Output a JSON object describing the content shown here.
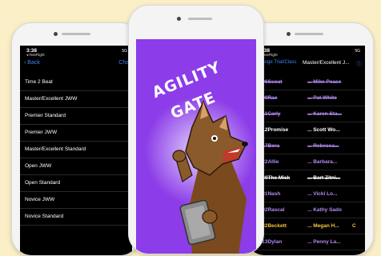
{
  "colors": {
    "background": "#fbefc7",
    "screen_purple": "#8c3ce8",
    "link_blue": "#3b82f6",
    "row_purple": "#b48cf2",
    "row_white": "#ffffff",
    "row_gold": "#f5c542"
  },
  "left_phone": {
    "time": "3:38",
    "carrier": "◂ TestFlight",
    "signal": "5G",
    "back_label": "Back",
    "partial_link": "Chan",
    "classes": [
      "Time 2 Beat",
      "Master/Excellent JWW",
      "Premier Standard",
      "Premier JWW",
      "Master/Excellent Standard",
      "Open JWW",
      "Open Standard",
      "Novice JWW",
      "Novice Standard"
    ]
  },
  "center_phone": {
    "app_title_line1": "AGILITY",
    "app_title_line2": "GATE",
    "mascot_icon": "dog-mascot-icon"
  },
  "right_phone": {
    "time": "3:38",
    "carrier": "◂ TestFlight",
    "signal": "5G",
    "back_label": "‹ Change Trial/Class",
    "header_title": "Master/Excellent J...",
    "runs": [
      {
        "dog": "1606Scout",
        "handler": "... Mike Pease",
        "extra": "",
        "color": "#b48cf2",
        "struck": true
      },
      {
        "dog": "1609Rae",
        "handler": "... Pat White",
        "extra": "",
        "color": "#b48cf2",
        "struck": true
      },
      {
        "dog": "1611Carly",
        "handler": "... Karen Sta...",
        "extra": "",
        "color": "#b48cf2",
        "struck": true
      },
      {
        "dog": "1612Promise",
        "handler": "... Scott Wo...",
        "extra": "",
        "color": "#ffffff",
        "struck": false
      },
      {
        "dog": "1617Bora",
        "handler": "... Rebecca...",
        "extra": "",
        "color": "#b48cf2",
        "struck": true
      },
      {
        "dog": "1622Allie",
        "handler": "... Barbara...",
        "extra": "",
        "color": "#b48cf2",
        "struck": false
      },
      {
        "dog": "1630The Mick",
        "handler": "... Bart Zitni...",
        "extra": "",
        "color": "#ffffff",
        "struck": true
      },
      {
        "dog": "2031Nash",
        "handler": "... Vicki Lo...",
        "extra": "",
        "color": "#b48cf2",
        "struck": false
      },
      {
        "dog": "1602Rascal",
        "handler": "... Kathy Sado",
        "extra": "",
        "color": "#b48cf2",
        "struck": false
      },
      {
        "dog": "1632Beckett",
        "handler": "... Megan H...",
        "extra": "C",
        "color": "#f5c542",
        "struck": false
      },
      {
        "dog": "1613Dylan",
        "handler": "... Penny La...",
        "extra": "",
        "color": "#b48cf2",
        "struck": false
      }
    ]
  }
}
